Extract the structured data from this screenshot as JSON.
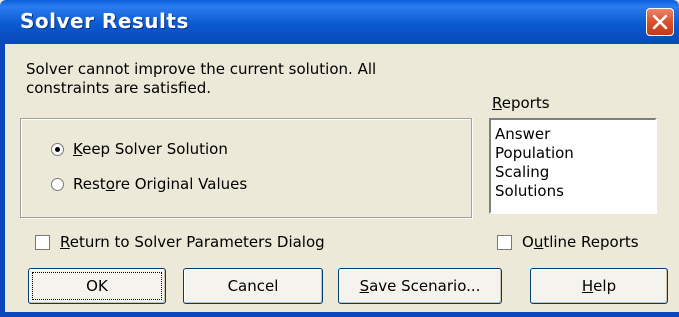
{
  "window": {
    "title": "Solver Results"
  },
  "message": {
    "line1": "Solver cannot improve the current solution.  All",
    "line2": "constraints are satisfied."
  },
  "options": {
    "keep": {
      "label_prefix": "",
      "hotkey": "K",
      "label_rest": "eep Solver Solution",
      "selected": true
    },
    "restore": {
      "label_prefix": "Rest",
      "hotkey": "o",
      "label_rest": "re Original Values",
      "selected": false
    }
  },
  "reports": {
    "label_prefix": "",
    "hotkey": "R",
    "label_rest": "eports",
    "items": [
      "Answer",
      "Population",
      "Scaling",
      "Solutions"
    ]
  },
  "return_checkbox": {
    "label_prefix": "",
    "hotkey": "R",
    "label_rest": "eturn to Solver Parameters Dialog",
    "checked": false
  },
  "outline_checkbox": {
    "label_prefix": "O",
    "hotkey": "u",
    "label_rest": "tline Reports",
    "checked": false
  },
  "buttons": {
    "ok": "OK",
    "cancel": "Cancel",
    "save_prefix": "",
    "save_hotkey": "S",
    "save_rest": "ave Scenario...",
    "help_prefix": "",
    "help_hotkey": "H",
    "help_rest": "elp"
  }
}
